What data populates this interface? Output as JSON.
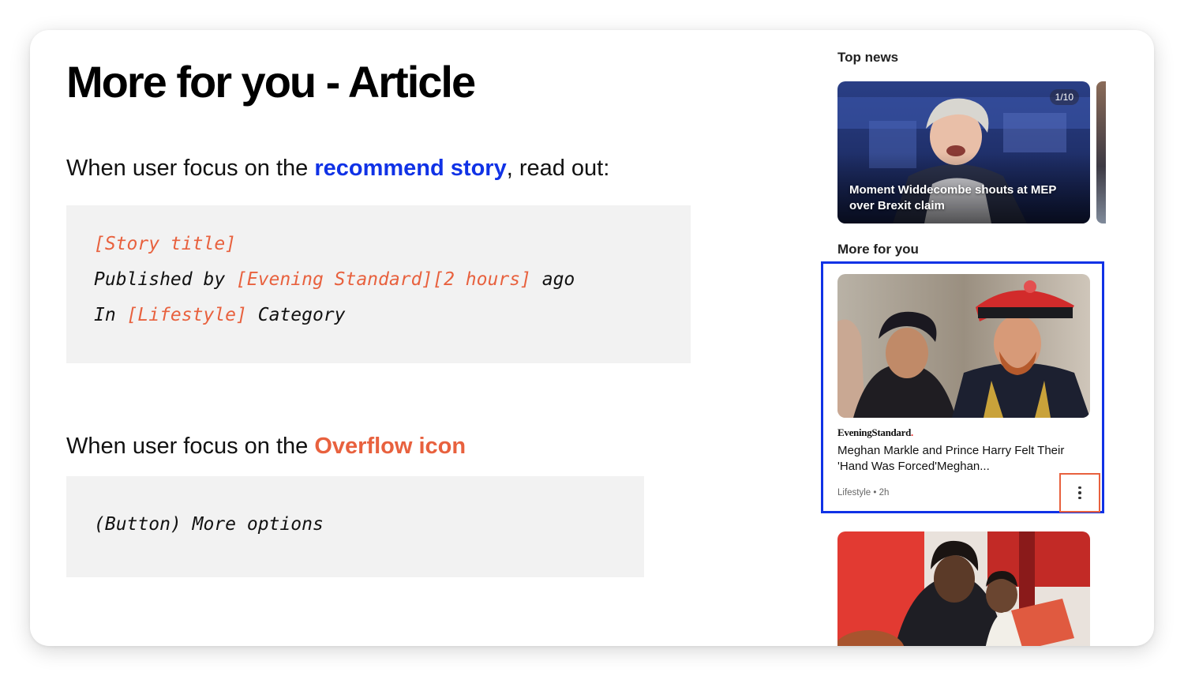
{
  "title": "More for you - Article",
  "section1": {
    "prompt_before": "When user focus on the ",
    "prompt_highlight": "recommend story",
    "prompt_after": ", read out:",
    "code_lines": {
      "line1_var": "[Story title]",
      "line2_text1": "Published by ",
      "line2_var1": "[Evening Standard][2 hours]",
      "line2_text2": " ago",
      "line3_text1": "In ",
      "line3_var1": "[Lifestyle]",
      "line3_text2": " Category"
    }
  },
  "section2": {
    "prompt_before": "When user focus on the ",
    "prompt_highlight": "Overflow icon",
    "code_line": "(Button) More options"
  },
  "panel": {
    "top_news_label": "Top news",
    "top_card": {
      "counter": "1/10",
      "headline": "Moment Widdecombe shouts at MEP over Brexit claim"
    },
    "more_for_you_label": "More for you",
    "story": {
      "publisher": "EveningStandard",
      "publisher_dot": ".",
      "title": "Meghan Markle and Prince Harry Felt Their 'Hand Was Forced'Meghan...",
      "meta": "Lifestyle • 2h",
      "overflow_icon": "more-vertical-icon"
    }
  },
  "colors": {
    "blue_highlight": "#1032e6",
    "orange_highlight": "#e8613e",
    "code_background": "#f2f2f2"
  }
}
